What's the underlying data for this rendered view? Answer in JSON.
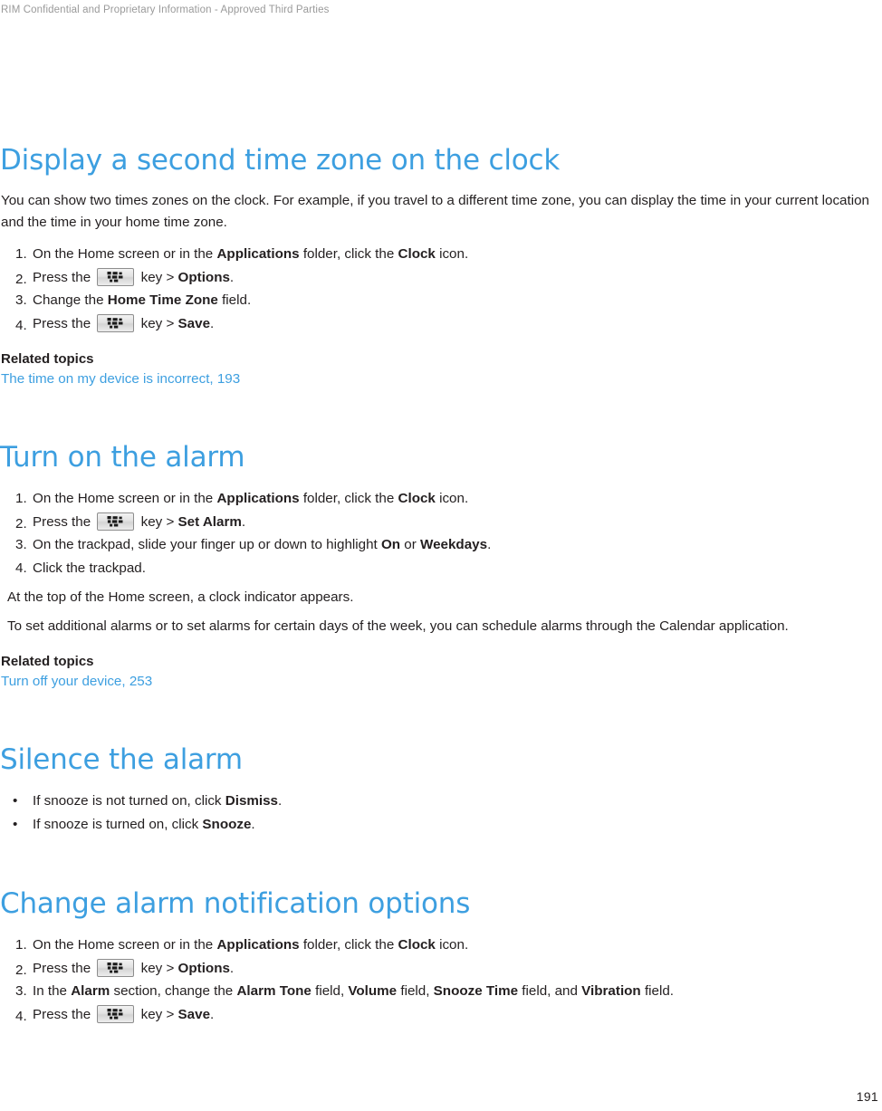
{
  "header": {
    "confidential_notice": "RIM Confidential and Proprietary Information - Approved Third Parties"
  },
  "footer": {
    "page_number": "191"
  },
  "colors": {
    "heading_blue": "#3d9fe0",
    "link_blue": "#3d9fe0",
    "body_text": "#231f20",
    "header_gray": "#9a9a9a"
  },
  "labels": {
    "related_topics": "Related topics",
    "menu_key_icon": "blackberry-menu-key-icon"
  },
  "sections": [
    {
      "title": "Display a second time zone on the clock",
      "intro": "You can show two times zones on the clock. For example, if you travel to a different time zone, you can display the time in your current location and the time in your home time zone.",
      "steps": [
        {
          "marker": "1.",
          "parts": [
            {
              "t": "On the Home screen or in the ",
              "b": false
            },
            {
              "t": "Applications",
              "b": true
            },
            {
              "t": " folder, click the ",
              "b": false
            },
            {
              "t": "Clock",
              "b": true
            },
            {
              "t": " icon.",
              "b": false
            }
          ]
        },
        {
          "marker": "2.",
          "parts": [
            {
              "t": "Press the ",
              "b": false
            },
            {
              "icon": "blackberry-menu-key-icon"
            },
            {
              "t": " key > ",
              "b": false
            },
            {
              "t": "Options",
              "b": true
            },
            {
              "t": ".",
              "b": false
            }
          ]
        },
        {
          "marker": "3.",
          "parts": [
            {
              "t": "Change the ",
              "b": false
            },
            {
              "t": "Home Time Zone",
              "b": true
            },
            {
              "t": " field.",
              "b": false
            }
          ]
        },
        {
          "marker": "4.",
          "parts": [
            {
              "t": "Press the ",
              "b": false
            },
            {
              "icon": "blackberry-menu-key-icon"
            },
            {
              "t": " key > ",
              "b": false
            },
            {
              "t": "Save",
              "b": true
            },
            {
              "t": ".",
              "b": false
            }
          ]
        }
      ],
      "notes": [],
      "related_topics": [
        "The time on my device is incorrect, 193"
      ]
    },
    {
      "title": "Turn on the alarm",
      "intro": null,
      "steps": [
        {
          "marker": "1.",
          "parts": [
            {
              "t": "On the Home screen or in the ",
              "b": false
            },
            {
              "t": "Applications",
              "b": true
            },
            {
              "t": " folder, click the ",
              "b": false
            },
            {
              "t": "Clock",
              "b": true
            },
            {
              "t": " icon.",
              "b": false
            }
          ]
        },
        {
          "marker": "2.",
          "parts": [
            {
              "t": "Press the ",
              "b": false
            },
            {
              "icon": "blackberry-menu-key-icon"
            },
            {
              "t": " key > ",
              "b": false
            },
            {
              "t": "Set Alarm",
              "b": true
            },
            {
              "t": ".",
              "b": false
            }
          ]
        },
        {
          "marker": "3.",
          "parts": [
            {
              "t": "On the trackpad, slide your finger up or down to highlight ",
              "b": false
            },
            {
              "t": "On",
              "b": true
            },
            {
              "t": " or ",
              "b": false
            },
            {
              "t": "Weekdays",
              "b": true
            },
            {
              "t": ".",
              "b": false
            }
          ]
        },
        {
          "marker": "4.",
          "parts": [
            {
              "t": "Click the trackpad.",
              "b": false
            }
          ]
        }
      ],
      "notes": [
        "At the top of the Home screen, a clock indicator appears.",
        "To set additional alarms or to set alarms for certain days of the week, you can schedule alarms through the Calendar application."
      ],
      "related_topics": [
        "Turn off your device, 253"
      ]
    },
    {
      "title": "Silence the alarm",
      "intro": null,
      "bullets": [
        {
          "marker": "•",
          "parts": [
            {
              "t": "If snooze is not turned on, click ",
              "b": false
            },
            {
              "t": "Dismiss",
              "b": true
            },
            {
              "t": ".",
              "b": false
            }
          ]
        },
        {
          "marker": "•",
          "parts": [
            {
              "t": "If snooze is turned on, click ",
              "b": false
            },
            {
              "t": "Snooze",
              "b": true
            },
            {
              "t": ".",
              "b": false
            }
          ]
        }
      ],
      "notes": [],
      "related_topics": []
    },
    {
      "title": "Change alarm notification options",
      "intro": null,
      "steps": [
        {
          "marker": "1.",
          "parts": [
            {
              "t": "On the Home screen or in the ",
              "b": false
            },
            {
              "t": "Applications",
              "b": true
            },
            {
              "t": " folder, click the ",
              "b": false
            },
            {
              "t": "Clock",
              "b": true
            },
            {
              "t": " icon.",
              "b": false
            }
          ]
        },
        {
          "marker": "2.",
          "parts": [
            {
              "t": "Press the ",
              "b": false
            },
            {
              "icon": "blackberry-menu-key-icon"
            },
            {
              "t": " key > ",
              "b": false
            },
            {
              "t": "Options",
              "b": true
            },
            {
              "t": ".",
              "b": false
            }
          ]
        },
        {
          "marker": "3.",
          "parts": [
            {
              "t": "In the ",
              "b": false
            },
            {
              "t": "Alarm",
              "b": true
            },
            {
              "t": " section, change the ",
              "b": false
            },
            {
              "t": "Alarm Tone",
              "b": true
            },
            {
              "t": " field, ",
              "b": false
            },
            {
              "t": "Volume",
              "b": true
            },
            {
              "t": " field, ",
              "b": false
            },
            {
              "t": "Snooze Time",
              "b": true
            },
            {
              "t": " field, and ",
              "b": false
            },
            {
              "t": "Vibration",
              "b": true
            },
            {
              "t": " field.",
              "b": false
            }
          ]
        },
        {
          "marker": "4.",
          "parts": [
            {
              "t": "Press the ",
              "b": false
            },
            {
              "icon": "blackberry-menu-key-icon"
            },
            {
              "t": " key > ",
              "b": false
            },
            {
              "t": "Save",
              "b": true
            },
            {
              "t": ".",
              "b": false
            }
          ]
        }
      ],
      "notes": [],
      "related_topics": []
    }
  ]
}
